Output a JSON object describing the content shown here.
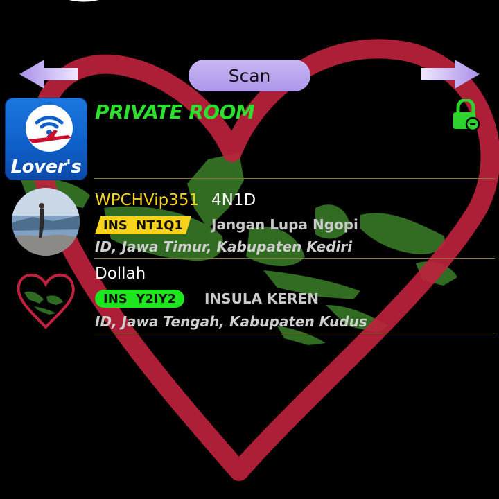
{
  "header": {
    "scan_label": "Scan"
  },
  "room": {
    "app_label": "Lover's",
    "title": "PRIVATE ROOM",
    "icons": {
      "app": "wifi-airplane-logo-icon",
      "lock": "lock-icon",
      "left": "arrow-left-icon",
      "right": "arrow-right-icon"
    }
  },
  "users": [
    {
      "name": "WPCHVip351",
      "status": "4N1D",
      "badge": "INS  NT1Q1",
      "note": "Jangan Lupa Ngopi",
      "location": "ID, Jawa Timur, Kabupaten Kediri",
      "name_color": "#f5d21c",
      "badge_color": "#f6d21a"
    },
    {
      "name": "Dollah",
      "status": "",
      "badge": "INS  Y2IY2",
      "note": "INSULA KEREN",
      "location": "ID, Jawa Tengah, Kabupaten Kudus",
      "name_color": "#ffffff",
      "badge_color": "#1ee61e"
    }
  ],
  "colors": {
    "heart": "#c0213d",
    "title_green": "#2de02d",
    "scan_button": "#b9a4ee",
    "map_green": "#3f8a2a"
  }
}
